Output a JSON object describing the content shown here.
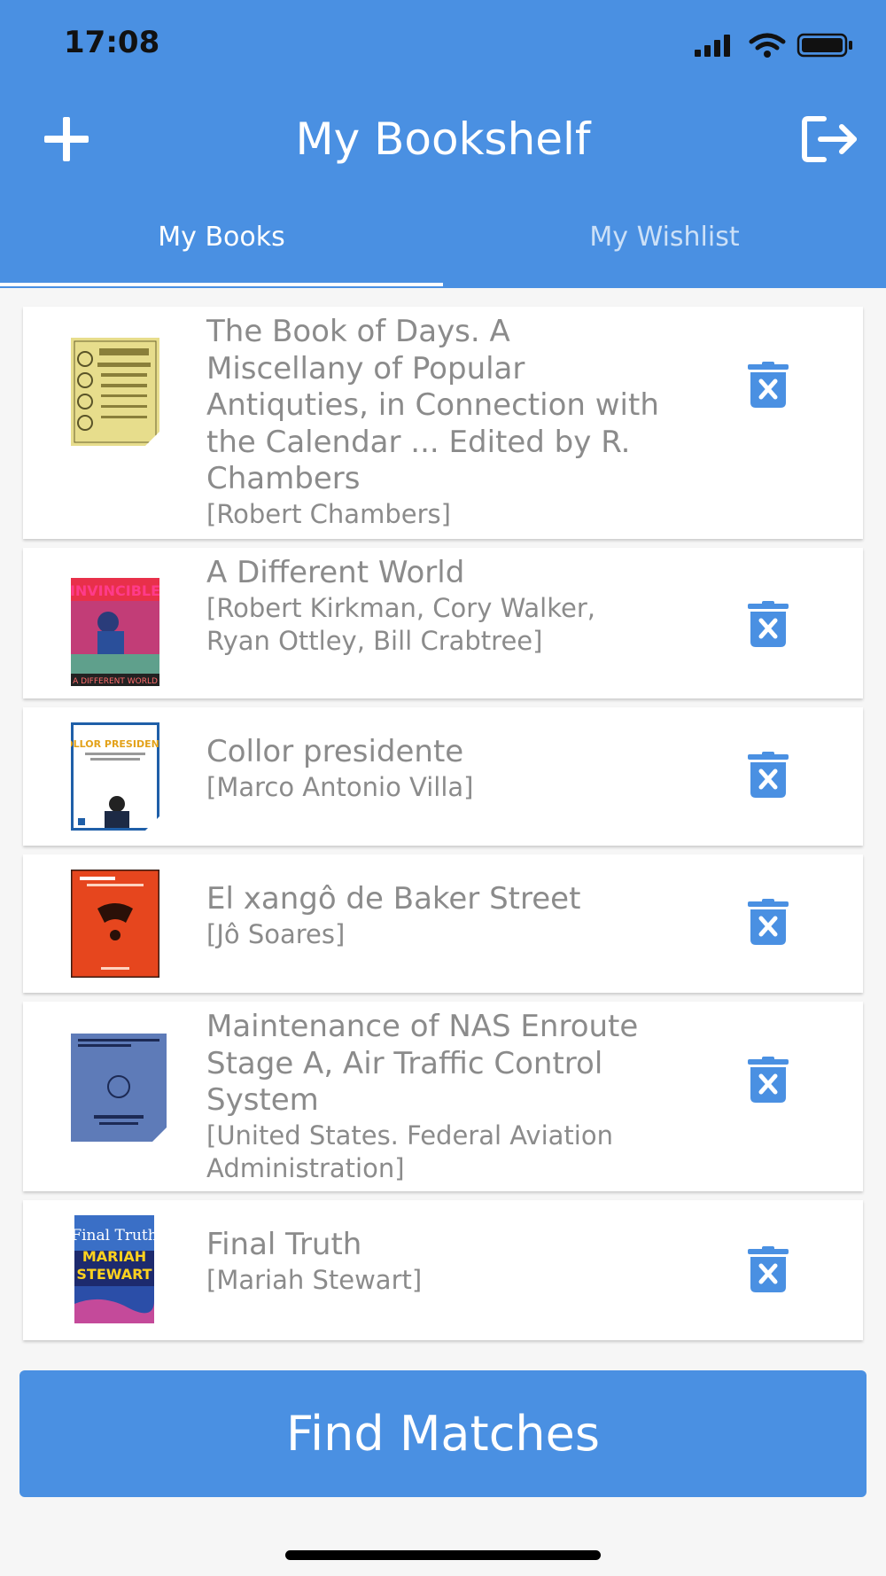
{
  "status_bar": {
    "time": "17:08"
  },
  "header": {
    "title": "My Bookshelf"
  },
  "tabs": [
    {
      "label": "My Books",
      "active": true
    },
    {
      "label": "My Wishlist",
      "active": false
    }
  ],
  "books": [
    {
      "title": "The Book of Days. A Miscellany of Popular Antiquties, in Connection with the Calendar ... Edited by R. Chambers",
      "author": "[Robert Chambers]"
    },
    {
      "title": "A Different World",
      "author": "[Robert Kirkman, Cory Walker, Ryan Ottley, Bill Crabtree]"
    },
    {
      "title": "Collor presidente",
      "author": "[Marco Antonio Villa]"
    },
    {
      "title": "El xangô de Baker Street",
      "author": "[Jô Soares]"
    },
    {
      "title": "Maintenance of NAS Enroute Stage A, Air Traffic Control System",
      "author": "[United States. Federal Aviation Administration]"
    },
    {
      "title": "Final Truth",
      "author": "[Mariah Stewart]"
    }
  ],
  "cover_texts": {
    "invincible": "INVINCIBLE",
    "different_world": "A DIFFERENT WORLD",
    "collor": "COLLOR PRESIDENTE",
    "final_truth": "Final Truth",
    "mariah": "MARIAH",
    "stewart": "STEWART"
  },
  "actions": {
    "find_matches": "Find Matches"
  },
  "colors": {
    "primary": "#4a90e2",
    "text_muted": "#8b8b8b",
    "background": "#f6f6f6"
  }
}
